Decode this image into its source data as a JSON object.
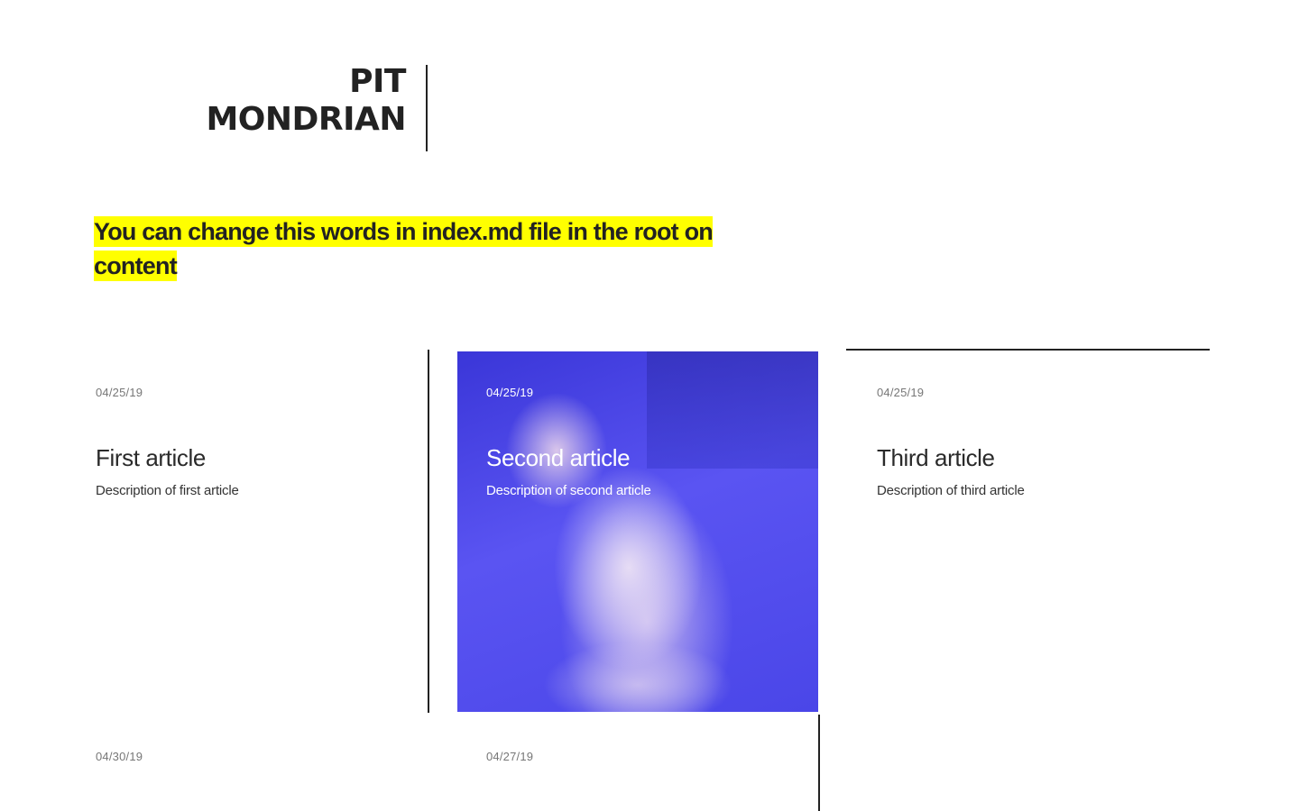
{
  "site": {
    "logo_line1": "PIT",
    "logo_line2": "MONDRIAN"
  },
  "tagline": "You can change this words in index.md file in the root on content",
  "articles": [
    {
      "date": "04/25/19",
      "title": "First article",
      "description": "Description of first article"
    },
    {
      "date": "04/25/19",
      "title": "Second article",
      "description": "Description of second article",
      "image": "cat-photo"
    },
    {
      "date": "04/25/19",
      "title": "Third article",
      "description": "Description of third article"
    },
    {
      "date": "04/30/19"
    },
    {
      "date": "04/27/19"
    }
  ],
  "colors": {
    "highlight": "#ffff00",
    "text": "#222222",
    "image_overlay": "#4a46e8"
  }
}
